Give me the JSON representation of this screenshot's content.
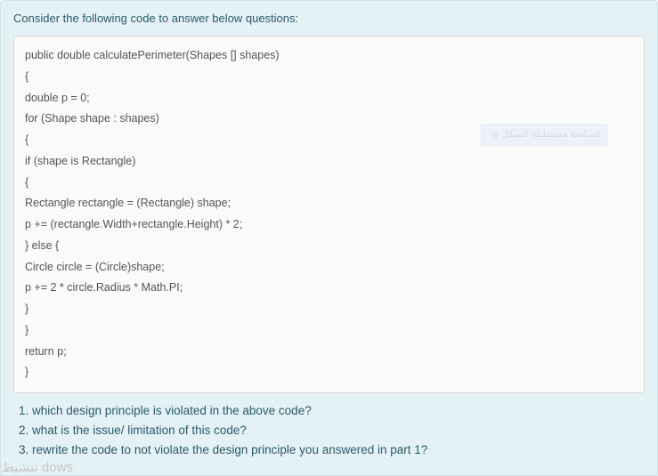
{
  "intro": "Consider the following code to answer below questions:",
  "code": {
    "l1": "public double calculatePerimeter(Shapes [] shapes)",
    "l2": "{",
    "l3": "double p = 0;",
    "l4": "",
    "l5": "for (Shape shape : shapes)",
    "l6": "{",
    "l7": "if (shape is Rectangle)",
    "l8": "{",
    "l9": "Rectangle rectangle = (Rectangle) shape;",
    "l10": "p += (rectangle.Width+rectangle.Height) * 2;",
    "l11": "} else {",
    "l12": "Circle circle = (Circle)shape;",
    "l13": "p += 2 * circle.Radius * Math.PI;",
    "l14": "}",
    "l15": "}",
    "l16": "return p;",
    "l17": "}"
  },
  "watermark_tag": "قصاصة مستطيلة الشكل",
  "questions": {
    "q1": "1. which design principle is violated in the above code?",
    "q2": "2. what is the issue/ limitation of this code?",
    "q3": "3. rewrite the code to not violate the design principle you answered in part 1?"
  },
  "footer_watermark": "dows تنشيط"
}
